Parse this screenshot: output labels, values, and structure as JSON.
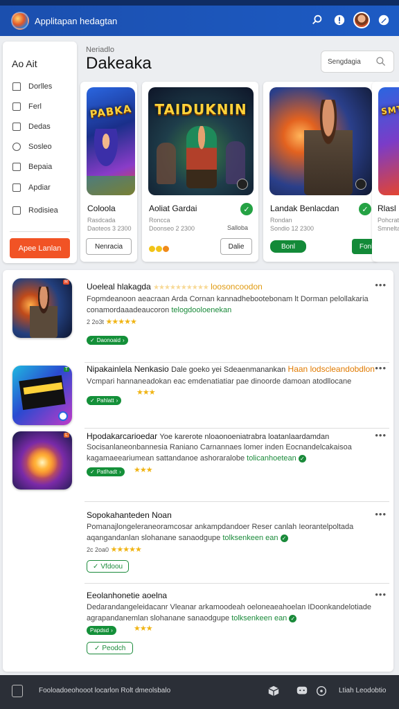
{
  "app": {
    "title": "Applitapan hedagtan"
  },
  "topbar": {
    "icons": [
      "search-icon",
      "notification-icon",
      "avatar",
      "settings-icon"
    ]
  },
  "sidebar": {
    "heading": "Ao Ait",
    "items": [
      {
        "label": "Dorlles",
        "icon": "home-icon"
      },
      {
        "label": "Ferl",
        "icon": "library-icon"
      },
      {
        "label": "Dedas",
        "icon": "calendar-icon"
      },
      {
        "label": "Sosleo",
        "icon": "social-icon"
      },
      {
        "label": "Bepaia",
        "icon": "gamepad-icon"
      },
      {
        "label": "Apdiar",
        "icon": "chart-icon"
      },
      {
        "label": "Rodisiea",
        "icon": "settings-icon"
      }
    ],
    "cta_label": "Apee Lanlan"
  },
  "header": {
    "subtitle": "Neriadlo",
    "title": "Dakeaka"
  },
  "search": {
    "placeholder": "Sengdagia"
  },
  "featured": [
    {
      "art_title": "PABKA",
      "title": "Coloola",
      "meta1": "Rasdcada",
      "meta2": "Daoteos 3 2300",
      "status": "",
      "button": "Nenracia"
    },
    {
      "art_title": "TAIDUKNIN",
      "title": "Aoliat Gardai",
      "meta1": "Roncca",
      "meta2": "Doonseo 2 2300",
      "status": "Salloba",
      "button": "Dalie"
    },
    {
      "art_title": "",
      "title": "Landak Benlacdan",
      "meta1": "Rondan",
      "meta2": "Sondio 12 2300",
      "status": "",
      "button_left": "Bonl",
      "button": "Fonlsin"
    },
    {
      "art_title": "SMT",
      "title": "Rlasl",
      "meta1": "Pohcrato",
      "meta2": "Smnelta",
      "status": "",
      "button": ""
    }
  ],
  "list": [
    {
      "title": "Uoeleal hlakagda",
      "title_extra": "loosoncoodon",
      "desc1": "Fopmdeanoon aeacraan Arda Cornan kannadhebootebonam lt Dorman pelollakaria",
      "desc2": "conamordaaadeaucoron",
      "desc2_link": "telogdooloenekan",
      "meta": "2 2o3t",
      "pill": "Daonoaid",
      "thumb_tag": "R"
    },
    {
      "title": "Nipakainlela Nenkasio",
      "title_extra2": "Dale goeko yei Sdeaenmanankan",
      "title_highlight": "Haan lodscleandobdlon",
      "desc1": "Vcmpari hannaneadokan eac emdenatiatiar pae dinoorde damoan atodllocane",
      "pill": "Pahlatt",
      "thumb_tag": "T"
    },
    {
      "title": "Hpodakarcarioedar",
      "title_extra2": "Yoe karerote nloaonoeniatrabra loatanlaardamdan",
      "desc1": "Socisanlaneonbannesia Raniano Carnannaes lomer inden Eocnandelcakaisoa",
      "desc2": "kagamaeeariumean sattandanoe ashoraralobe",
      "desc2_link": "tolicanhoetean",
      "pill": "Patlhadt",
      "thumb_tag": "L"
    },
    {
      "title": "Sopokahanteden Noan",
      "desc1": "Pomanajlongeleraneoramcosar ankampdandoer Reser canlah Ieorantelpoltada",
      "desc2": "aqangandanlan slohanane sanaodgupe",
      "desc2_link": "tolksenkeen ean",
      "meta": "2c 2oa0",
      "pill": "Vfdoou"
    },
    {
      "title": "Eeolanhonetie aoelna",
      "desc1": "Dedarandangeleidacanr Vleanar arkamoodeah oeloneaeahoelan IDoonkandelotiade",
      "desc2": "agrapandanemlan slohanane sanaodgupe",
      "desc2_link": "tolksenkeen ean",
      "pill": "Papdsd",
      "pill2": "Peodch"
    }
  ],
  "bottombar": {
    "text": "Fooloadoeohooot locarlon Rolt dmeolsbalo",
    "right_text": "Ltiah Leodobtio",
    "icons": [
      "document-icon",
      "package-icon",
      "chat-icon",
      "help-icon"
    ]
  }
}
